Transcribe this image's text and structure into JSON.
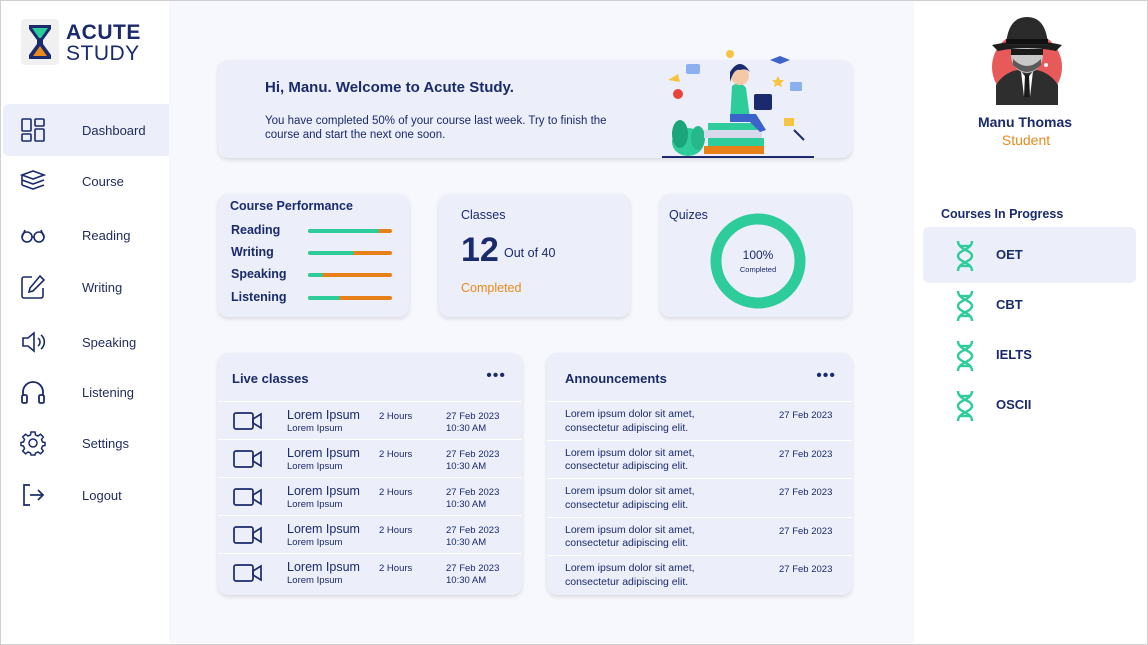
{
  "brand": {
    "line1": "ACUTE",
    "line2": "STUDY"
  },
  "nav": [
    {
      "label": "Dashboard",
      "icon": "dashboard-icon",
      "active": true
    },
    {
      "label": "Course",
      "icon": "books-icon"
    },
    {
      "label": "Reading",
      "icon": "glasses-icon"
    },
    {
      "label": "Writing",
      "icon": "edit-icon"
    },
    {
      "label": "Speaking",
      "icon": "speaker-icon"
    },
    {
      "label": "Listening",
      "icon": "headphones-icon"
    },
    {
      "label": "Settings",
      "icon": "gear-icon"
    },
    {
      "label": "Logout",
      "icon": "logout-icon"
    }
  ],
  "welcome": {
    "title": "Hi, Manu. Welcome to Acute Study.",
    "text": "You have completed 50% of your course last week. Try to finish the course and start the next one soon."
  },
  "performance": {
    "title": "Course Performance",
    "items": [
      {
        "label": "Reading",
        "progress": 0.85
      },
      {
        "label": "Writing",
        "progress": 0.55
      },
      {
        "label": "Speaking",
        "progress": 0.18
      },
      {
        "label": "Listening",
        "progress": 0.38
      }
    ]
  },
  "classes": {
    "title": "Classes",
    "count": "12",
    "of_text": "Out of 40",
    "status": "Completed"
  },
  "quizes": {
    "title": "Quizes",
    "percent": "100%",
    "label": "Completed",
    "progress": 1.0
  },
  "live_classes": {
    "title": "Live classes",
    "more": "•••",
    "rows": [
      {
        "title": "Lorem Ipsum",
        "sub": "Lorem Ipsum",
        "duration": "2 Hours",
        "date": "27 Feb 2023",
        "time": "10:30 AM"
      },
      {
        "title": "Lorem Ipsum",
        "sub": "Lorem Ipsum",
        "duration": "2 Hours",
        "date": "27 Feb 2023",
        "time": "10:30 AM"
      },
      {
        "title": "Lorem Ipsum",
        "sub": "Lorem Ipsum",
        "duration": "2 Hours",
        "date": "27 Feb 2023",
        "time": "10:30 AM"
      },
      {
        "title": "Lorem Ipsum",
        "sub": "Lorem Ipsum",
        "duration": "2 Hours",
        "date": "27 Feb 2023",
        "time": "10:30 AM"
      },
      {
        "title": "Lorem Ipsum",
        "sub": "Lorem Ipsum",
        "duration": "2 Hours",
        "date": "27 Feb 2023",
        "time": "10:30 AM"
      }
    ]
  },
  "announcements": {
    "title": "Announcements",
    "more": "•••",
    "rows": [
      {
        "text": "Lorem ipsum dolor sit amet, consectetur adipiscing elit.",
        "date": "27 Feb 2023"
      },
      {
        "text": "Lorem ipsum dolor sit amet, consectetur adipiscing elit.",
        "date": "27 Feb 2023"
      },
      {
        "text": "Lorem ipsum dolor sit amet, consectetur adipiscing elit.",
        "date": "27 Feb 2023"
      },
      {
        "text": "Lorem ipsum dolor sit amet, consectetur adipiscing elit.",
        "date": "27 Feb 2023"
      },
      {
        "text": "Lorem ipsum dolor sit amet, consectetur adipiscing elit.",
        "date": "27 Feb 2023"
      }
    ]
  },
  "user": {
    "name": "Manu Thomas",
    "role": "Student"
  },
  "courses_in_progress": {
    "title": "Courses In Progress",
    "items": [
      {
        "label": "OET",
        "active": true
      },
      {
        "label": "CBT"
      },
      {
        "label": "IELTS"
      },
      {
        "label": "OSCII"
      }
    ]
  },
  "colors": {
    "navy": "#1a2a6c",
    "accent_orange": "#e88a1c",
    "accent_green": "#2ecc9a",
    "card_bg": "#eceef9"
  }
}
